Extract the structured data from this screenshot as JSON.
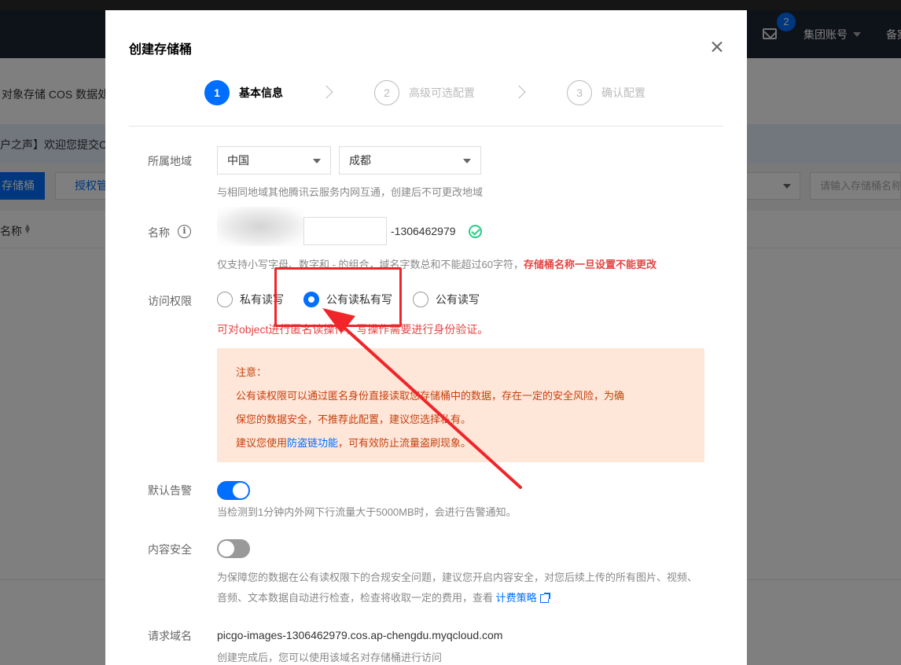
{
  "background": {
    "badge_count": "2",
    "account_label": "集团账号",
    "extra_label": "备案",
    "breadcrumb": "对象存储 COS 数据处",
    "notice": "户之声】欢迎您提交CO",
    "create_button": "存储桶",
    "auth_button": "授权管",
    "search_placeholder": "请输入存储桶名称",
    "column_name": "名称"
  },
  "modal": {
    "title": "创建存储桶",
    "steps": [
      {
        "number": "1",
        "label": "基本信息",
        "active": true
      },
      {
        "number": "2",
        "label": "高级可选配置",
        "active": false
      },
      {
        "number": "3",
        "label": "确认配置",
        "active": false
      }
    ],
    "region": {
      "label": "所属地域",
      "country": "中国",
      "city": "成都",
      "help": "与相同地域其他腾讯云服务内网互通，创建后不可更改地域"
    },
    "name": {
      "label": "名称",
      "value": "",
      "suffix": "-1306462979",
      "rule": "仅支持小写字母、数字和 - 的组合，域名字数总和不能超过60字符，",
      "rule_strong": "存储桶名称一旦设置不能更改"
    },
    "access": {
      "label": "访问权限",
      "options": [
        "私有读写",
        "公有读私有写",
        "公有读写"
      ],
      "selected": "公有读私有写",
      "tip": "可对object进行匿名读操作，写操作需要进行身份验证。"
    },
    "warning": {
      "title": "注意：",
      "line1": "公有读权限可以通过匿名身份直接读取您存储桶中的数据，存在一定的安全风险，为确",
      "line2": "保您的数据安全，不推荐此配置，建议您选择私有。",
      "line3_pre": "建议您使用",
      "line3_link": "防盗链功能",
      "line3_post": "，可有效防止流量盗刷现象。"
    },
    "alarm": {
      "label": "默认告警",
      "enabled": true,
      "help": "当检测到1分钟内外网下行流量大于5000MB时，会进行告警通知。"
    },
    "content_security": {
      "label": "内容安全",
      "enabled": false,
      "help": "为保障您的数据在公有读权限下的合规安全问题，建议您开启内容安全，对您后续上传的所有图片、视频、音频、文本数据自动进行检查，检查将收取一定的费用，查看 ",
      "link": "计费策略"
    },
    "domain": {
      "label": "请求域名",
      "value": "picgo-images-1306462979.cos.ap-chengdu.myqcloud.com",
      "help": "创建完成后，您可以使用该域名对存储桶进行访问"
    }
  },
  "colors": {
    "primary": "#006eff",
    "danger": "#e54545",
    "success": "#29cc85",
    "warning_bg": "#fee6d9",
    "warning_text": "#c7410c",
    "annotation": "#f0252a"
  }
}
